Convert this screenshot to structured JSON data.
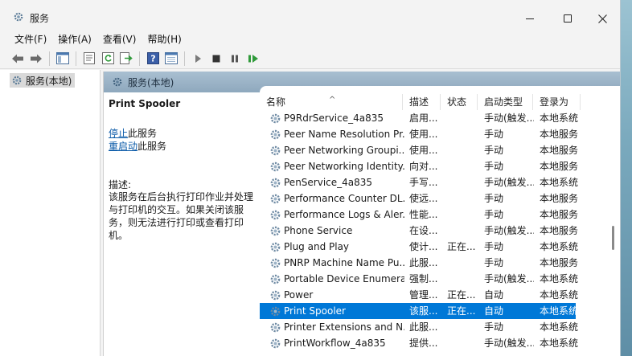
{
  "window": {
    "title": "服务",
    "icon": "gear-icon"
  },
  "menu": [
    "文件(F)",
    "操作(A)",
    "查看(V)",
    "帮助(H)"
  ],
  "toolbar": {
    "icons": [
      "back-arrow-icon",
      "forward-arrow-icon",
      "console-tree-icon",
      "properties-icon",
      "refresh-icon",
      "export-icon",
      "help-icon",
      "view-icon",
      "play-icon",
      "stop-icon",
      "pause-icon",
      "resume-icon"
    ]
  },
  "tree": {
    "node_label": "服务(本地)"
  },
  "panel": {
    "header": "服务(本地)",
    "selected_service_title": "Print Spooler",
    "stop_link": "停止",
    "stop_suffix": "此服务",
    "restart_link": "重启动",
    "restart_suffix": "此服务",
    "desc_label": "描述:",
    "desc_text": "该服务在后台执行打印作业并处理与打印机的交互。如果关闭该服务，则无法进行打印或查看打印机。"
  },
  "list": {
    "columns": [
      "名称",
      "描述",
      "状态",
      "启动类型",
      "登录为"
    ],
    "rows": [
      {
        "name": "P9RdrService_4a835",
        "desc": "启用...",
        "status": "",
        "start": "手动(触发...",
        "logon": "本地系统"
      },
      {
        "name": "Peer Name Resolution Pr...",
        "desc": "使用...",
        "status": "",
        "start": "手动",
        "logon": "本地服务"
      },
      {
        "name": "Peer Networking Groupi...",
        "desc": "使用...",
        "status": "",
        "start": "手动",
        "logon": "本地服务"
      },
      {
        "name": "Peer Networking Identity...",
        "desc": "向对...",
        "status": "",
        "start": "手动",
        "logon": "本地服务"
      },
      {
        "name": "PenService_4a835",
        "desc": "手写...",
        "status": "",
        "start": "手动(触发...",
        "logon": "本地系统"
      },
      {
        "name": "Performance Counter DL...",
        "desc": "使远...",
        "status": "",
        "start": "手动",
        "logon": "本地服务"
      },
      {
        "name": "Performance Logs & Aler...",
        "desc": "性能...",
        "status": "",
        "start": "手动",
        "logon": "本地服务"
      },
      {
        "name": "Phone Service",
        "desc": "在设...",
        "status": "",
        "start": "手动(触发...",
        "logon": "本地服务"
      },
      {
        "name": "Plug and Play",
        "desc": "使计...",
        "status": "正在...",
        "start": "手动",
        "logon": "本地系统"
      },
      {
        "name": "PNRP Machine Name Pu...",
        "desc": "此服...",
        "status": "",
        "start": "手动",
        "logon": "本地服务"
      },
      {
        "name": "Portable Device Enumera...",
        "desc": "强制...",
        "status": "",
        "start": "手动(触发...",
        "logon": "本地系统"
      },
      {
        "name": "Power",
        "desc": "管理...",
        "status": "正在...",
        "start": "自动",
        "logon": "本地系统"
      },
      {
        "name": "Print Spooler",
        "desc": "该服...",
        "status": "正在...",
        "start": "自动",
        "logon": "本地系统",
        "selected": true
      },
      {
        "name": "Printer Extensions and N...",
        "desc": "此服...",
        "status": "",
        "start": "手动",
        "logon": "本地系统"
      },
      {
        "name": "PrintWorkflow_4a835",
        "desc": "提供...",
        "status": "",
        "start": "手动(触发...",
        "logon": "本地系统"
      }
    ]
  },
  "colors": {
    "selection": "#0078d7",
    "panel_header": "#9fb6c9",
    "link": "#0a5aa8"
  }
}
